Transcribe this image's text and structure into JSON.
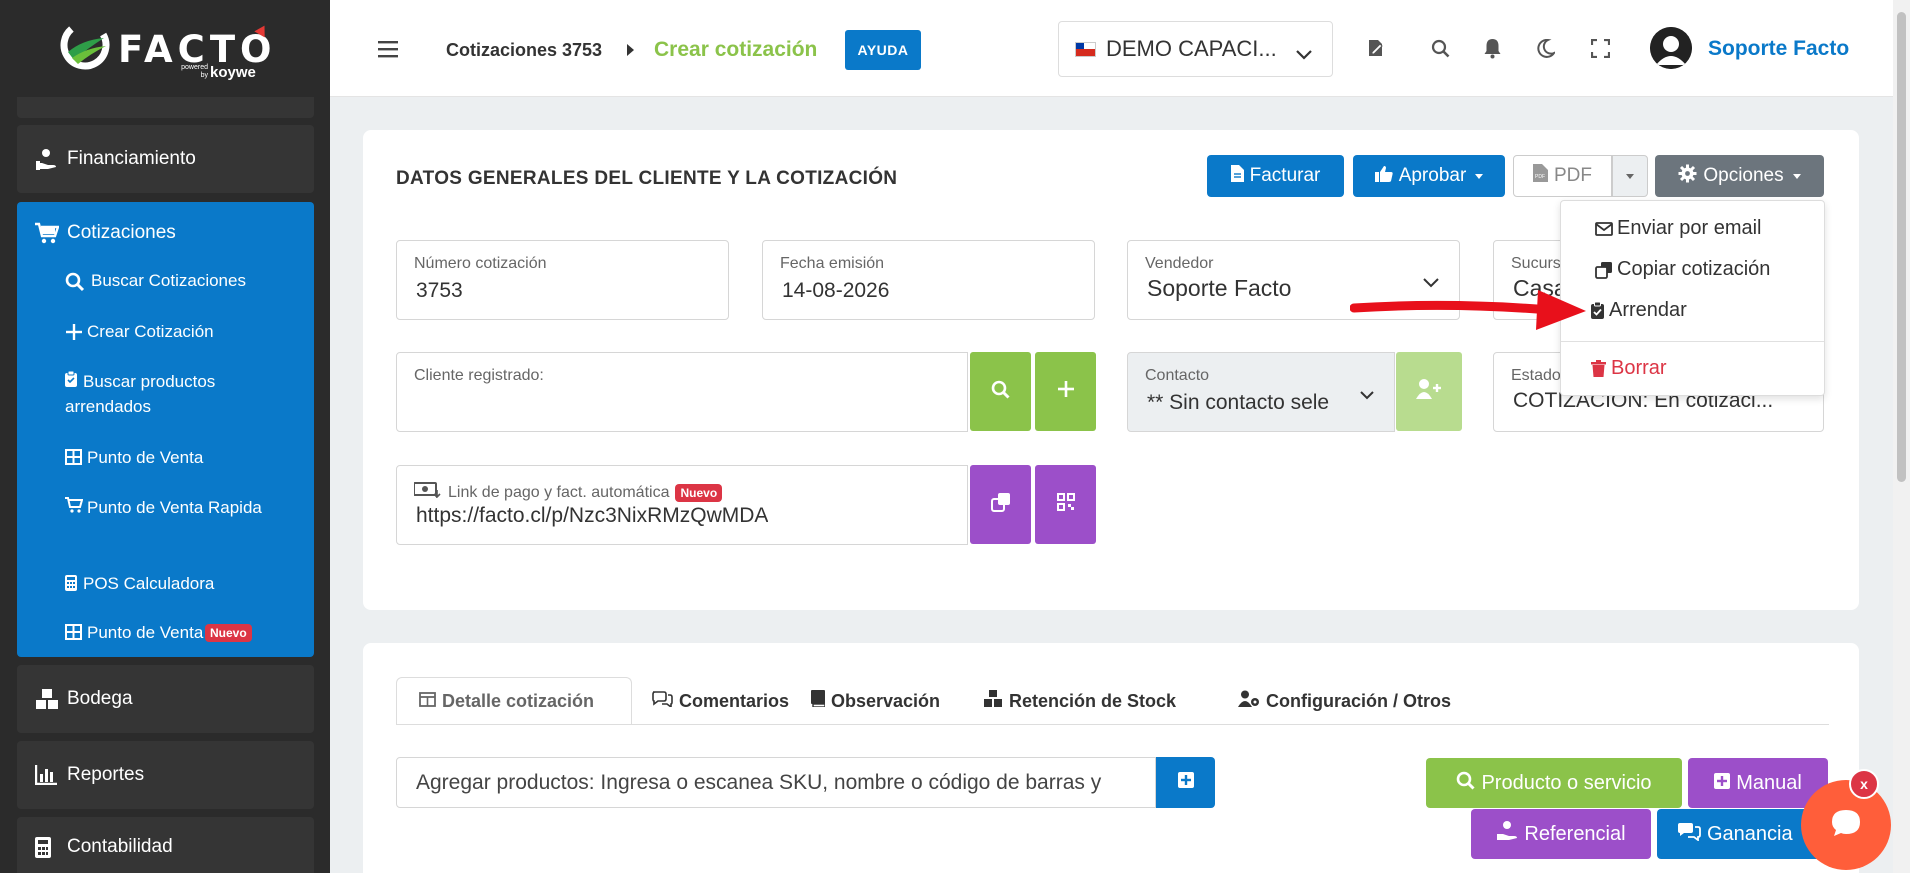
{
  "brand": {
    "logo_text": "FACTO",
    "powered_by": "powered by",
    "partner": "koywe"
  },
  "sidebar": {
    "items": [
      {
        "label": "Financiamiento",
        "icon": "hand-money-icon"
      },
      {
        "label": "Bodega",
        "icon": "boxes-icon"
      },
      {
        "label": "Reportes",
        "icon": "bar-chart-icon"
      },
      {
        "label": "Contabilidad",
        "icon": "calculator-icon"
      }
    ],
    "cotizaciones": {
      "label": "Cotizaciones",
      "subitems": [
        {
          "label": "Buscar Cotizaciones"
        },
        {
          "label": "Crear Cotización"
        },
        {
          "label": "Buscar productos arrendados"
        },
        {
          "label": "Punto de Venta"
        },
        {
          "label": "Punto de Venta Rapida"
        },
        {
          "label": "POS Calculadora"
        },
        {
          "label": "Punto de Venta",
          "badge": "Nuevo"
        }
      ]
    }
  },
  "topbar": {
    "breadcrumb_parent": "Cotizaciones 3753",
    "breadcrumb_current": "Crear cotización",
    "help_label": "AYUDA",
    "company": "DEMO CAPACI...",
    "user_name": "Soporte Facto"
  },
  "card": {
    "title": "DATOS GENERALES DEL CLIENTE Y LA COTIZACIÓN",
    "buttons": {
      "facturar": "Facturar",
      "aprobar": "Aprobar",
      "pdf": "PDF",
      "opciones": "Opciones"
    },
    "fields": {
      "numero": {
        "label": "Número cotización",
        "value": "3753"
      },
      "fecha": {
        "label": "Fecha emisión",
        "value": "14-08-2026"
      },
      "vendedor": {
        "label": "Vendedor",
        "value": "Soporte Facto"
      },
      "sucursal": {
        "label": "Sucurs",
        "value": "Casa"
      },
      "cliente": {
        "label": "Cliente registrado:",
        "value": ""
      },
      "contacto": {
        "label": "Contacto",
        "value": "** Sin contacto sele"
      },
      "estado": {
        "label": "Estado",
        "value": "COTIZACIÓN: En cotizaci..."
      },
      "link": {
        "label": "Link de pago y fact. automática",
        "badge": "Nuevo",
        "value": "https://facto.cl/p/Nzc3NixRMzQwMDA"
      }
    }
  },
  "options_menu": {
    "items": [
      {
        "label": "Enviar por email",
        "icon": "envelope-icon"
      },
      {
        "label": "Copiar cotización",
        "icon": "copy-icon"
      },
      {
        "label": "Arrendar",
        "icon": "clipboard-check-icon"
      },
      {
        "label": "Borrar",
        "icon": "trash-icon",
        "color": "#dc3545"
      }
    ]
  },
  "detail": {
    "tabs": [
      {
        "label": "Detalle cotización"
      },
      {
        "label": "Comentarios"
      },
      {
        "label": "Observación"
      },
      {
        "label": "Retención de Stock"
      },
      {
        "label": "Configuración / Otros"
      }
    ],
    "product_placeholder": "Agregar productos: Ingresa o escanea SKU, nombre o código de barras y",
    "buttons": {
      "producto": "Producto o servicio",
      "manual": "Manual",
      "referencial": "Referencial",
      "ganancia": "Ganancia"
    }
  },
  "chat": {
    "close_label": "x"
  },
  "colors": {
    "primary": "#0a79c9",
    "green": "#8bc34a",
    "purple": "#9c4fc9",
    "gray_btn": "#6c757d",
    "danger": "#dc3545",
    "sidebar": "#2b2b2b",
    "annotation_arrow": "#e8101b"
  }
}
